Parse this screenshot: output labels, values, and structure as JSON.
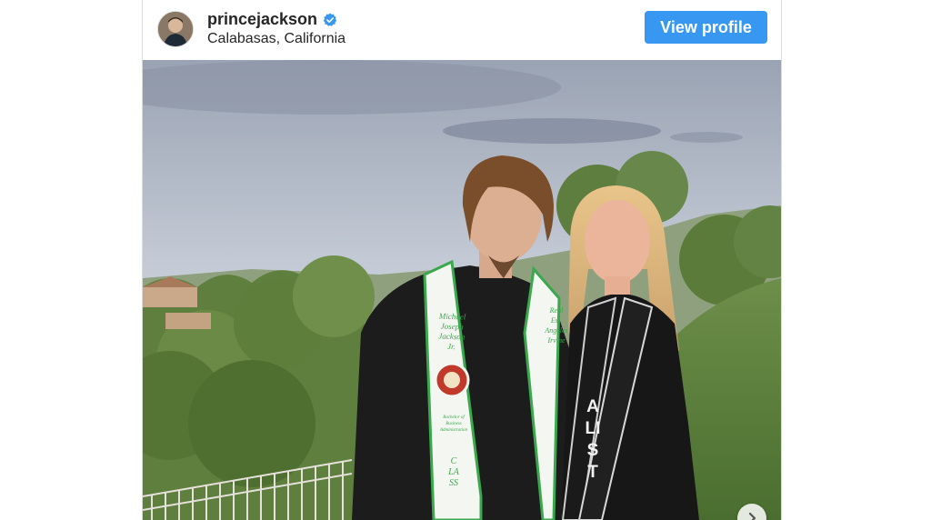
{
  "post": {
    "username": "princejackson",
    "verified": true,
    "location": "Calabasas, California",
    "view_profile_label": "View profile"
  },
  "photo": {
    "stole_left_text": [
      "Michael",
      "Joseph",
      "Jackson",
      "Jr."
    ],
    "stole_left_lower": [
      "Bachelor of",
      "Business",
      "Administration"
    ],
    "stole_left_bottom": "CLASS",
    "stole_right_text": [
      "Real",
      "Est.",
      "Angeles",
      "Irvine"
    ],
    "stole_woman_text": "ALIST"
  },
  "icons": {
    "verified": "verified-badge-icon",
    "next": "chevron-right-icon"
  },
  "colors": {
    "button": "#3897f0",
    "verified": "#3897f0"
  }
}
